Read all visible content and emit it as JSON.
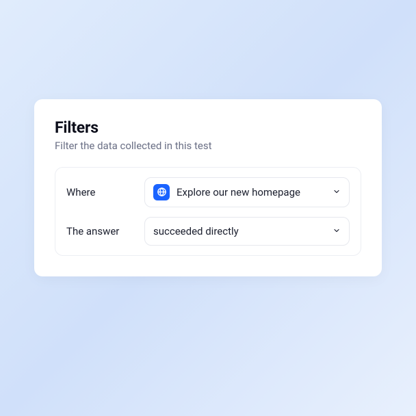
{
  "card": {
    "title": "Filters",
    "subtitle": "Filter the data collected in this test"
  },
  "filters": {
    "where": {
      "label": "Where",
      "selected": "Explore our new homepage",
      "icon": "globe-icon"
    },
    "answer": {
      "label": "The answer",
      "selected": "succeeded directly"
    }
  },
  "colors": {
    "accent": "#1a63ff"
  }
}
